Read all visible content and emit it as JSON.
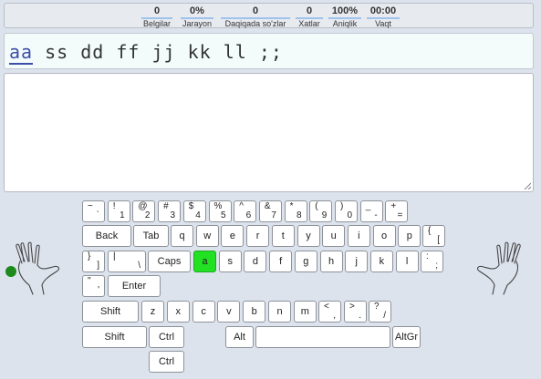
{
  "stats": [
    {
      "value": "0",
      "label": "Belgilar"
    },
    {
      "value": "0%",
      "label": "Jarayon"
    },
    {
      "value": "0",
      "label": "Daqiqada so'zlar"
    },
    {
      "value": "0",
      "label": "Xatlar"
    },
    {
      "value": "100%",
      "label": "Aniqlik"
    },
    {
      "value": "00:00",
      "label": "Vaqt"
    }
  ],
  "target": {
    "current": "aa",
    "rest": " ss dd ff jj kk ll ;;"
  },
  "typing_area": {
    "value": ""
  },
  "keyboard": {
    "highlight_color": "#22e022",
    "num_row": [
      {
        "top": "~",
        "bottom": "`"
      },
      {
        "top": "!",
        "bottom": "1"
      },
      {
        "top": "@",
        "bottom": "2"
      },
      {
        "top": "#",
        "bottom": "3"
      },
      {
        "top": "$",
        "bottom": "4"
      },
      {
        "top": "%",
        "bottom": "5"
      },
      {
        "top": "^",
        "bottom": "6"
      },
      {
        "top": "&",
        "bottom": "7"
      },
      {
        "top": "*",
        "bottom": "8"
      },
      {
        "top": "(",
        "bottom": "9"
      },
      {
        "top": ")",
        "bottom": "0"
      },
      {
        "top": "_",
        "bottom": "-"
      },
      {
        "top": "+",
        "bottom": "="
      }
    ],
    "back": "Back",
    "tab": "Tab",
    "top_letters": [
      "q",
      "w",
      "e",
      "r",
      "t",
      "y",
      "u",
      "i",
      "o",
      "p"
    ],
    "lbrace": {
      "top": "{",
      "bottom": "["
    },
    "rbrace": {
      "top": "}",
      "bottom": "]"
    },
    "pipe": {
      "top": "|",
      "bottom": "\\"
    },
    "caps": "Caps",
    "home_letters": [
      "a",
      "s",
      "d",
      "f",
      "g",
      "h",
      "j",
      "k",
      "l"
    ],
    "colon": {
      "top": ":",
      "bottom": ";"
    },
    "quote": {
      "top": "\"",
      "bottom": "'"
    },
    "enter": "Enter",
    "shift": "Shift",
    "bottom_letters": [
      "z",
      "x",
      "c",
      "v",
      "b",
      "n",
      "m"
    ],
    "lt": {
      "top": "<",
      "bottom": ","
    },
    "gt": {
      "top": ">",
      "bottom": "."
    },
    "question": {
      "top": "?",
      "bottom": "/"
    },
    "shift2": "Shift",
    "ctrl": "Ctrl",
    "alt": "Alt",
    "altgr": "AltGr",
    "ctrl2": "Ctrl"
  }
}
